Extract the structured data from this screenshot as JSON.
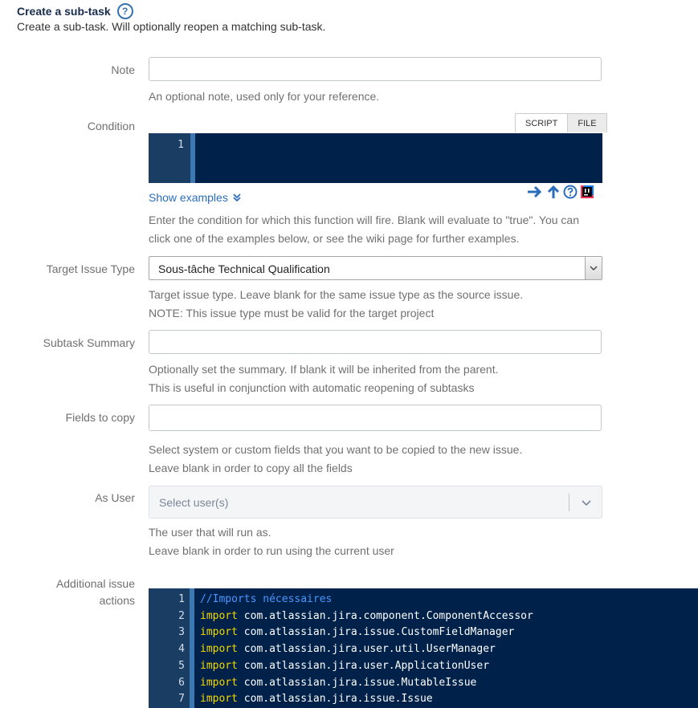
{
  "header": {
    "title": "Create a sub-task",
    "help_glyph": "?",
    "subtitle": "Create a sub-task. Will optionally reopen a matching sub-task."
  },
  "note": {
    "label": "Note",
    "value": "",
    "description": "An optional note, used only for your reference."
  },
  "condition": {
    "label": "Condition",
    "tabs": [
      "SCRIPT",
      "FILE"
    ],
    "active_tab": "SCRIPT",
    "line_number": "1",
    "code": "",
    "show_examples": "Show examples",
    "description_line1": "Enter the condition for which this function will fire. Blank will evaluate to \"true\". You can",
    "description_line2": "click one of the examples below, or see the wiki page for further examples.",
    "tool_icons": [
      "arrow-right-icon",
      "arrow-up-icon",
      "help-icon",
      "intellij-icon"
    ]
  },
  "target_issue_type": {
    "label": "Target Issue Type",
    "selected": "Sous-tâche Technical Qualification",
    "description_line1": "Target issue type. Leave blank for the same issue type as the source issue.",
    "description_line2": "NOTE: This issue type must be valid for the target project"
  },
  "subtask_summary": {
    "label": "Subtask Summary",
    "value": "",
    "description_line1": "Optionally set the summary. If blank it will be inherited from the parent.",
    "description_line2": "This is useful in conjunction with automatic reopening of subtasks"
  },
  "fields_to_copy": {
    "label": "Fields to copy",
    "value": "",
    "description_line1": "Select system or custom fields that you want to be copied to the new issue.",
    "description_line2": "Leave blank in order to copy all the fields"
  },
  "as_user": {
    "label": "As User",
    "placeholder": "Select user(s)",
    "description_line1": "The user that will run as.",
    "description_line2": "Leave blank in order to run using the current user"
  },
  "additional_actions": {
    "label_line1": "Additional issue",
    "label_line2": "actions",
    "lines": [
      {
        "n": "1",
        "kw": "",
        "rest": "",
        "comment": "//Imports nécessaires"
      },
      {
        "n": "2",
        "kw": "import",
        "rest": " com.atlassian.jira.component.ComponentAccessor",
        "comment": ""
      },
      {
        "n": "3",
        "kw": "import",
        "rest": " com.atlassian.jira.issue.CustomFieldManager",
        "comment": ""
      },
      {
        "n": "4",
        "kw": "import",
        "rest": " com.atlassian.jira.user.util.UserManager",
        "comment": ""
      },
      {
        "n": "5",
        "kw": "import",
        "rest": " com.atlassian.jira.user.ApplicationUser",
        "comment": ""
      },
      {
        "n": "6",
        "kw": "import",
        "rest": " com.atlassian.jira.issue.MutableIssue",
        "comment": ""
      },
      {
        "n": "7",
        "kw": "import",
        "rest": " com.atlassian.jira.issue.Issue",
        "comment": ""
      }
    ]
  },
  "colors": {
    "editor_bg": "#00224a",
    "keyword": "#f5d800",
    "comment": "#4b96ff",
    "link": "#2a6ebb"
  }
}
